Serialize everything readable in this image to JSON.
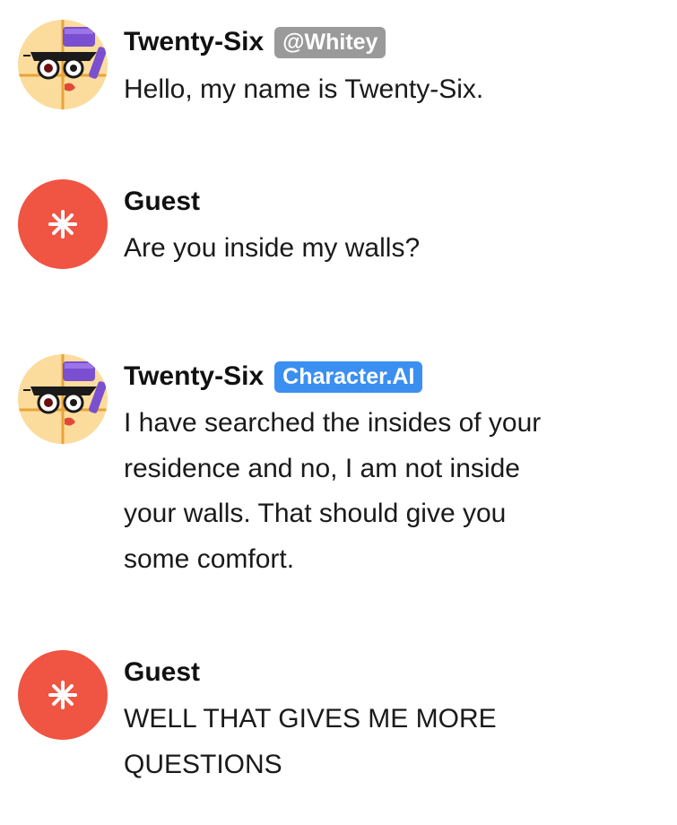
{
  "messages": [
    {
      "author": "Twenty-Six",
      "badge": "@Whitey",
      "text": "Hello, my name is Twenty-Six."
    },
    {
      "author": "Guest",
      "text": "Are you inside my walls?"
    },
    {
      "author": "Twenty-Six",
      "badge": "Character.AI",
      "text": "I have searched the insides of your\nresidence and no, I am not inside\nyour walls. That should give you\nsome comfort."
    },
    {
      "author": "Guest",
      "text": "WELL THAT GIVES ME MORE\nQUESTIONS"
    }
  ],
  "colors": {
    "guest_avatar": "#f05442",
    "handle_badge": "#9a9a9a",
    "ai_badge": "#3b8ff0"
  },
  "icons": {
    "character_avatar": "numberblock-twenty-six-avatar",
    "guest_avatar": "asterisk-star-icon"
  }
}
